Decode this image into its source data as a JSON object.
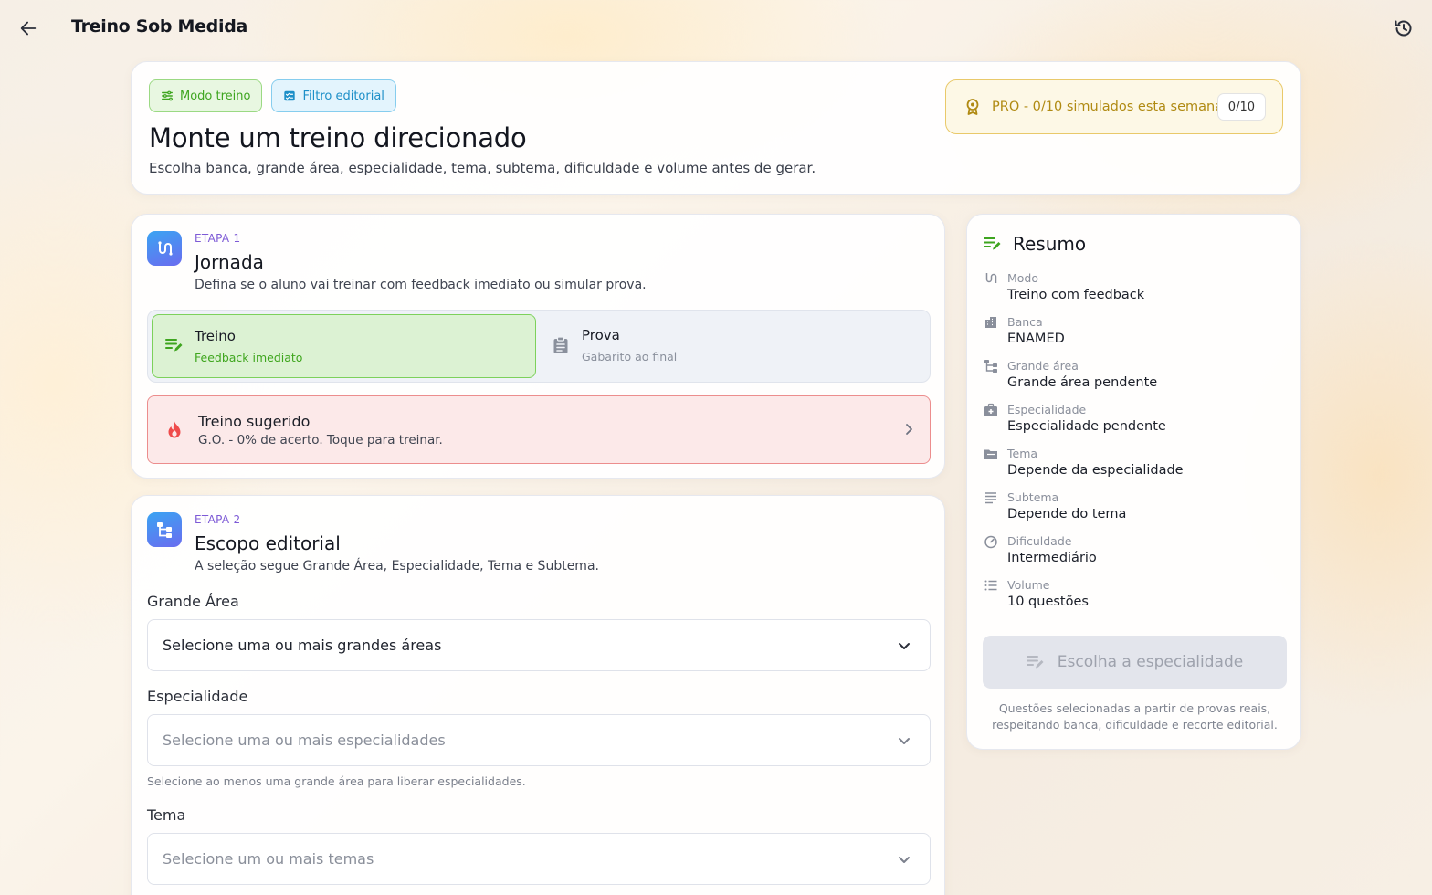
{
  "app": {
    "title": "Treino Sob Medida"
  },
  "header": {
    "chips": {
      "mode": "Modo treino",
      "filter": "Filtro editorial"
    },
    "title": "Monte um treino direcionado",
    "subtitle": "Escolha banca, grande área, especialidade, tema, subtema, dificuldade e volume antes de gerar.",
    "pro": {
      "text": "PRO - 0/10 simulados esta semana",
      "count": "0/10"
    }
  },
  "stage1": {
    "tag": "ETAPA 1",
    "title": "Jornada",
    "description": "Defina se o aluno vai treinar com feedback imediato ou simular prova.",
    "options": [
      {
        "label": "Treino",
        "sub": "Feedback imediato",
        "selected": true
      },
      {
        "label": "Prova",
        "sub": "Gabarito ao final",
        "selected": false
      }
    ],
    "suggestion": {
      "title": "Treino sugerido",
      "text": "G.O. - 0% de acerto. Toque para treinar."
    }
  },
  "stage2": {
    "tag": "ETAPA 2",
    "title": "Escopo editorial",
    "description": "A seleção segue Grande Área, Especialidade, Tema e Subtema.",
    "fields": {
      "grande_area": {
        "label": "Grande Área",
        "placeholder": "Selecione uma ou mais grandes áreas"
      },
      "especialidade": {
        "label": "Especialidade",
        "placeholder": "Selecione uma ou mais especialidades",
        "hint": "Selecione ao menos uma grande área para liberar especialidades."
      },
      "tema": {
        "label": "Tema",
        "placeholder": "Selecione um ou mais temas"
      }
    }
  },
  "summary": {
    "title": "Resumo",
    "rows": [
      {
        "label": "Modo",
        "value": "Treino com feedback",
        "icon": "route-icon"
      },
      {
        "label": "Banca",
        "value": "ENAMED",
        "icon": "building-icon"
      },
      {
        "label": "Grande área",
        "value": "Grande área pendente",
        "icon": "hierarchy-icon"
      },
      {
        "label": "Especialidade",
        "value": "Especialidade pendente",
        "icon": "medical-bag-icon"
      },
      {
        "label": "Tema",
        "value": "Depende da especialidade",
        "icon": "folder-icon"
      },
      {
        "label": "Subtema",
        "value": "Depende do tema",
        "icon": "lines-icon"
      },
      {
        "label": "Dificuldade",
        "value": "Intermediário",
        "icon": "gauge-icon"
      },
      {
        "label": "Volume",
        "value": "10 questões",
        "icon": "list-icon"
      }
    ],
    "button": "Escolha a especialidade",
    "footer": "Questões selecionadas a partir de provas reais, respeitando banca, dificuldade e recorte editorial."
  },
  "colors": {
    "accent_green": "#3ea51f",
    "accent_blue": "#1d8fc8",
    "pro_gold": "#b08a12",
    "stage_purple": "#7d5ad6",
    "suggest_red": "#ec8d8d"
  }
}
